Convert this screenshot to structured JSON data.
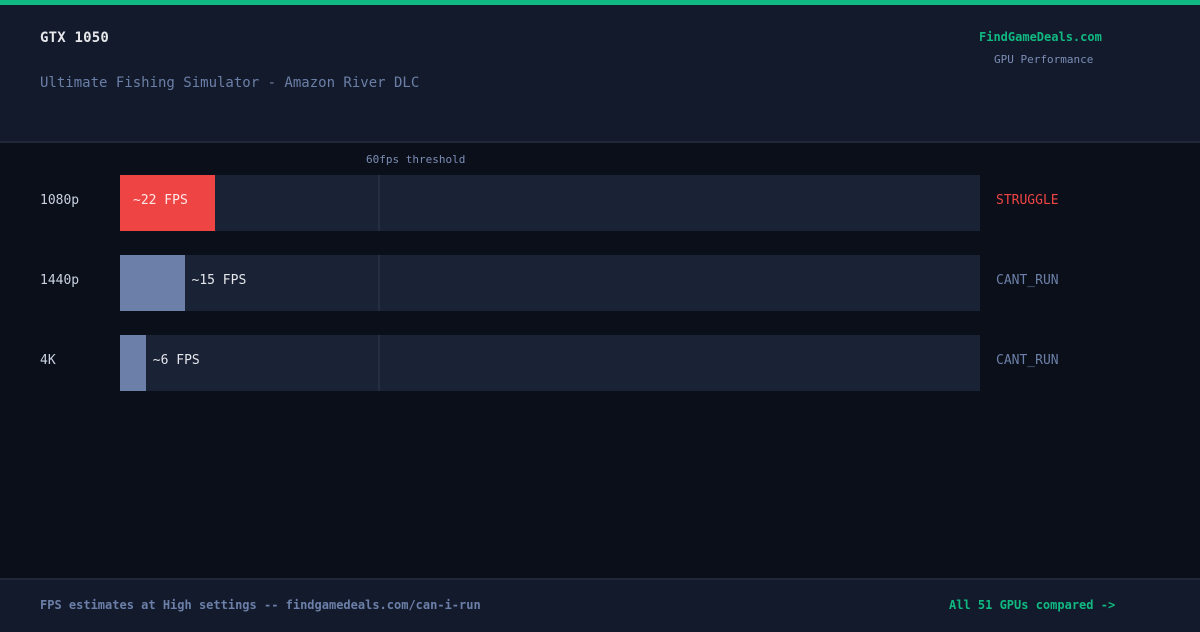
{
  "header": {
    "gpu": "GTX 1050",
    "game": "Ultimate Fishing Simulator - Amazon River DLC",
    "brand": "FindGameDeals.com",
    "brand_sub": "GPU Performance"
  },
  "chart_data": {
    "type": "bar",
    "orientation": "horizontal",
    "threshold": {
      "label": "60fps threshold",
      "value": 60
    },
    "xlim": [
      0,
      200
    ],
    "categories": [
      "1080p",
      "1440p",
      "4K"
    ],
    "values": [
      22,
      15,
      6
    ],
    "value_labels": [
      "~22 FPS",
      "~15 FPS",
      "~6 FPS"
    ],
    "status": [
      "STRUGGLE",
      "CANT_RUN",
      "CANT_RUN"
    ],
    "status_colors": {
      "STRUGGLE": "#ef4444",
      "CANT_RUN": "#6b7fa8"
    },
    "bar_colors": {
      "STRUGGLE": "#ef4444",
      "CANT_RUN": "#6b7fa8"
    }
  },
  "footer": {
    "note": "FPS estimates at High settings -- findgamedeals.com/can-i-run",
    "link": "All 51 GPUs compared ->"
  }
}
